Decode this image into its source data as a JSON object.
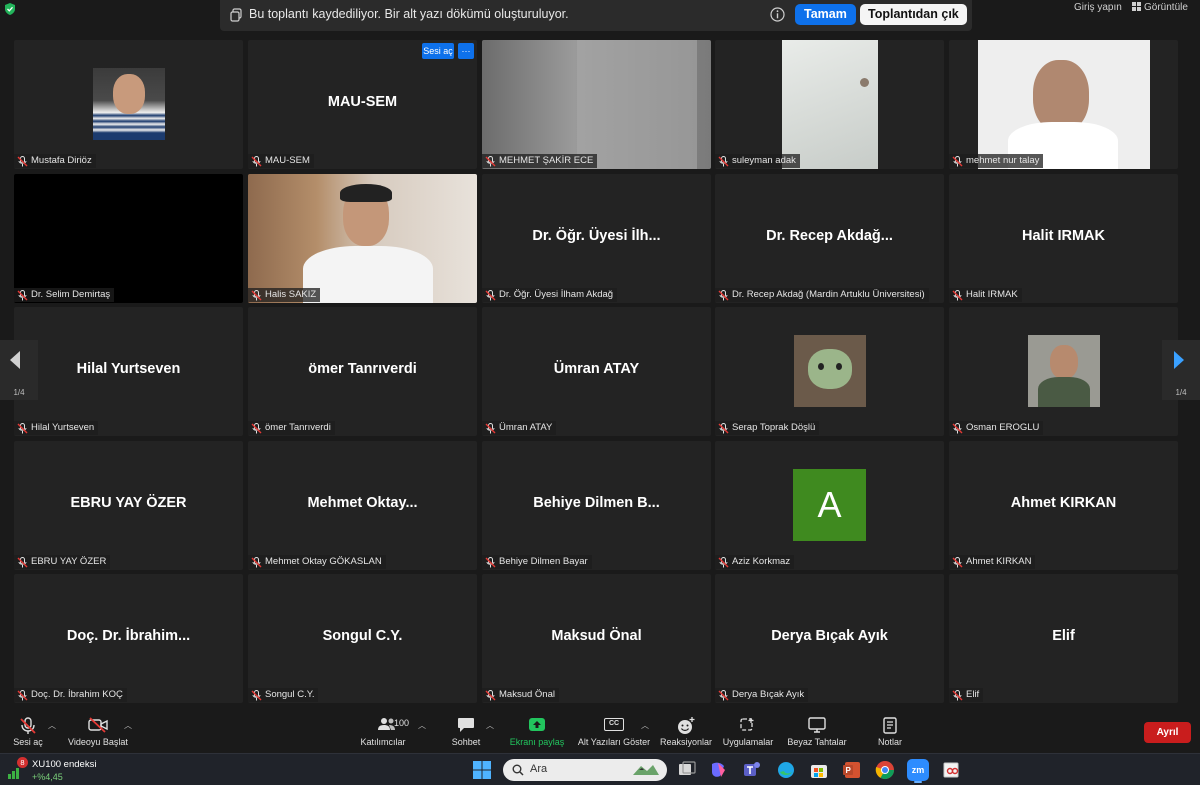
{
  "banner": {
    "message": "Bu toplantı kaydediliyor. Bir alt yazı dökümü oluşturuluyor.",
    "ok_label": "Tamam",
    "leave_label": "Toplantıdan çık"
  },
  "topright": {
    "signin": "Giriş yapın",
    "view": "Görüntüle"
  },
  "tile_controls": {
    "unmute": "Sesi aç",
    "more": "···"
  },
  "participants": [
    {
      "big": "",
      "label": "Mustafa Diriöz"
    },
    {
      "big": "MAU-SEM",
      "label": "MAU-SEM"
    },
    {
      "big": "",
      "label": "MEHMET ŞAKİR ECE"
    },
    {
      "big": "",
      "label": "suleyman adak"
    },
    {
      "big": "",
      "label": "mehmet nur talay"
    },
    {
      "big": "",
      "label": "Dr. Selim Demirtaş"
    },
    {
      "big": "",
      "label": "Halis SAKIZ"
    },
    {
      "big": "Dr. Öğr. Üyesi İlh...",
      "label": "Dr. Öğr. Üyesi İlham Akdağ"
    },
    {
      "big": "Dr. Recep Akdağ...",
      "label": "Dr. Recep Akdağ (Mardin Artuklu Üniversitesi)"
    },
    {
      "big": "Halit IRMAK",
      "label": "Halit IRMAK"
    },
    {
      "big": "Hilal Yurtseven",
      "label": "Hilal Yurtseven"
    },
    {
      "big": "ömer Tanrıverdi",
      "label": "ömer Tanrıverdi"
    },
    {
      "big": "Ümran ATAY",
      "label": "Ümran ATAY"
    },
    {
      "big": "",
      "label": "Serap Toprak Döşlü"
    },
    {
      "big": "",
      "label": "Osman EROGLU"
    },
    {
      "big": "EBRU YAY ÖZER",
      "label": "EBRU YAY ÖZER"
    },
    {
      "big": "Mehmet  Oktay...",
      "label": "Mehmet Oktay GÖKASLAN"
    },
    {
      "big": "Behiye  Dilmen  B...",
      "label": "Behiye Dilmen Bayar"
    },
    {
      "big": "A",
      "label": "Aziz Korkmaz"
    },
    {
      "big": "Ahmet KIRKAN",
      "label": "Ahmet KIRKAN"
    },
    {
      "big": "Doç.  Dr.  İbrahim...",
      "label": "Doç. Dr. İbrahim KOÇ"
    },
    {
      "big": "Songul C.Y.",
      "label": "Songul C.Y."
    },
    {
      "big": "Maksud Önal",
      "label": "Maksud Önal"
    },
    {
      "big": "Derya Bıçak Ayık",
      "label": "Derya Bıçak Ayık"
    },
    {
      "big": "Elif",
      "label": "Elif"
    }
  ],
  "pager": {
    "left": "1/4",
    "right": "1/4"
  },
  "toolbar": {
    "mute": "Sesi aç",
    "video": "Videoyu Başlat",
    "participants": "Katılımcılar",
    "participants_count": "100",
    "chat": "Sohbet",
    "share": "Ekranı paylaş",
    "captions": "Alt Yazıları Göster",
    "captions_icon": "CC",
    "reactions": "Reaksiyonlar",
    "apps": "Uygulamalar",
    "whiteboard": "Beyaz Tahtalar",
    "notes": "Notlar",
    "leave": "Ayrıl"
  },
  "taskbar": {
    "ticker_name": "XU100 endeksi",
    "ticker_change": "+%4,45",
    "ticker_badge": "8",
    "search_placeholder": "Ara",
    "zoom_label": "zm"
  }
}
